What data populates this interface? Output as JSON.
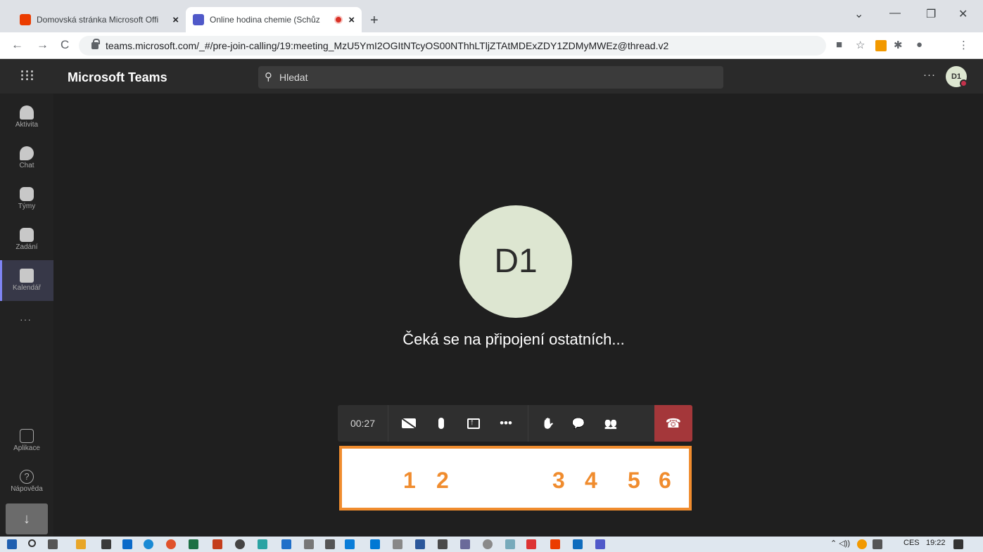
{
  "browser": {
    "tabs": [
      {
        "title": "Domovská stránka Microsoft Offi",
        "close": "×"
      },
      {
        "title": "Online hodina chemie (Schůz",
        "close": "×"
      }
    ],
    "new_tab": "+",
    "window_controls": {
      "chevron": "⌄",
      "minimize": "—",
      "restore": "❐",
      "close": "✕"
    },
    "nav": {
      "back": "←",
      "forward": "→",
      "reload": "C"
    },
    "url": "teams.microsoft.com/_#/pre-join-calling/19:meeting_MzU5YmI2OGItNTcyOS00NThhLTljZTAtMDExZDY1ZDMyMWEz@thread.v2",
    "extensions": {
      "camera": "■",
      "star": "☆",
      "puzzle": "✱",
      "profile": "●",
      "menu": "⋮"
    }
  },
  "teams": {
    "brand": "Microsoft Teams",
    "apps_glyph": "⁝⁝⁝",
    "search_placeholder": "Hledat",
    "more": "···",
    "user_initials": "D1",
    "rail": [
      {
        "label": "Aktivita"
      },
      {
        "label": "Chat"
      },
      {
        "label": "Týmy"
      },
      {
        "label": "Zadání"
      },
      {
        "label": "Kalendář"
      }
    ],
    "rail_more": "···",
    "rail_bottom": [
      {
        "label": "Aplikace"
      },
      {
        "label": "Nápověda",
        "glyph": "?"
      }
    ],
    "download_glyph": "↓"
  },
  "meeting": {
    "avatar_initials": "D1",
    "status": "Čeká se na připojení ostatních...",
    "timer": "00:27",
    "more": "•••",
    "hand": "✋",
    "chat": "💬",
    "participants": "👥",
    "hangup": "☎"
  },
  "annotation": {
    "numbers": [
      "1",
      "2",
      "3",
      "4",
      "5",
      "6"
    ],
    "color": "#f08c2e"
  },
  "taskbar": {
    "tray": {
      "language": "CES",
      "time": "19:22"
    }
  },
  "colors": {
    "teams_bg": "#1f1f1f",
    "rail_active": "#373848",
    "leave": "#a4373a",
    "avatar": "#dde6d1"
  }
}
